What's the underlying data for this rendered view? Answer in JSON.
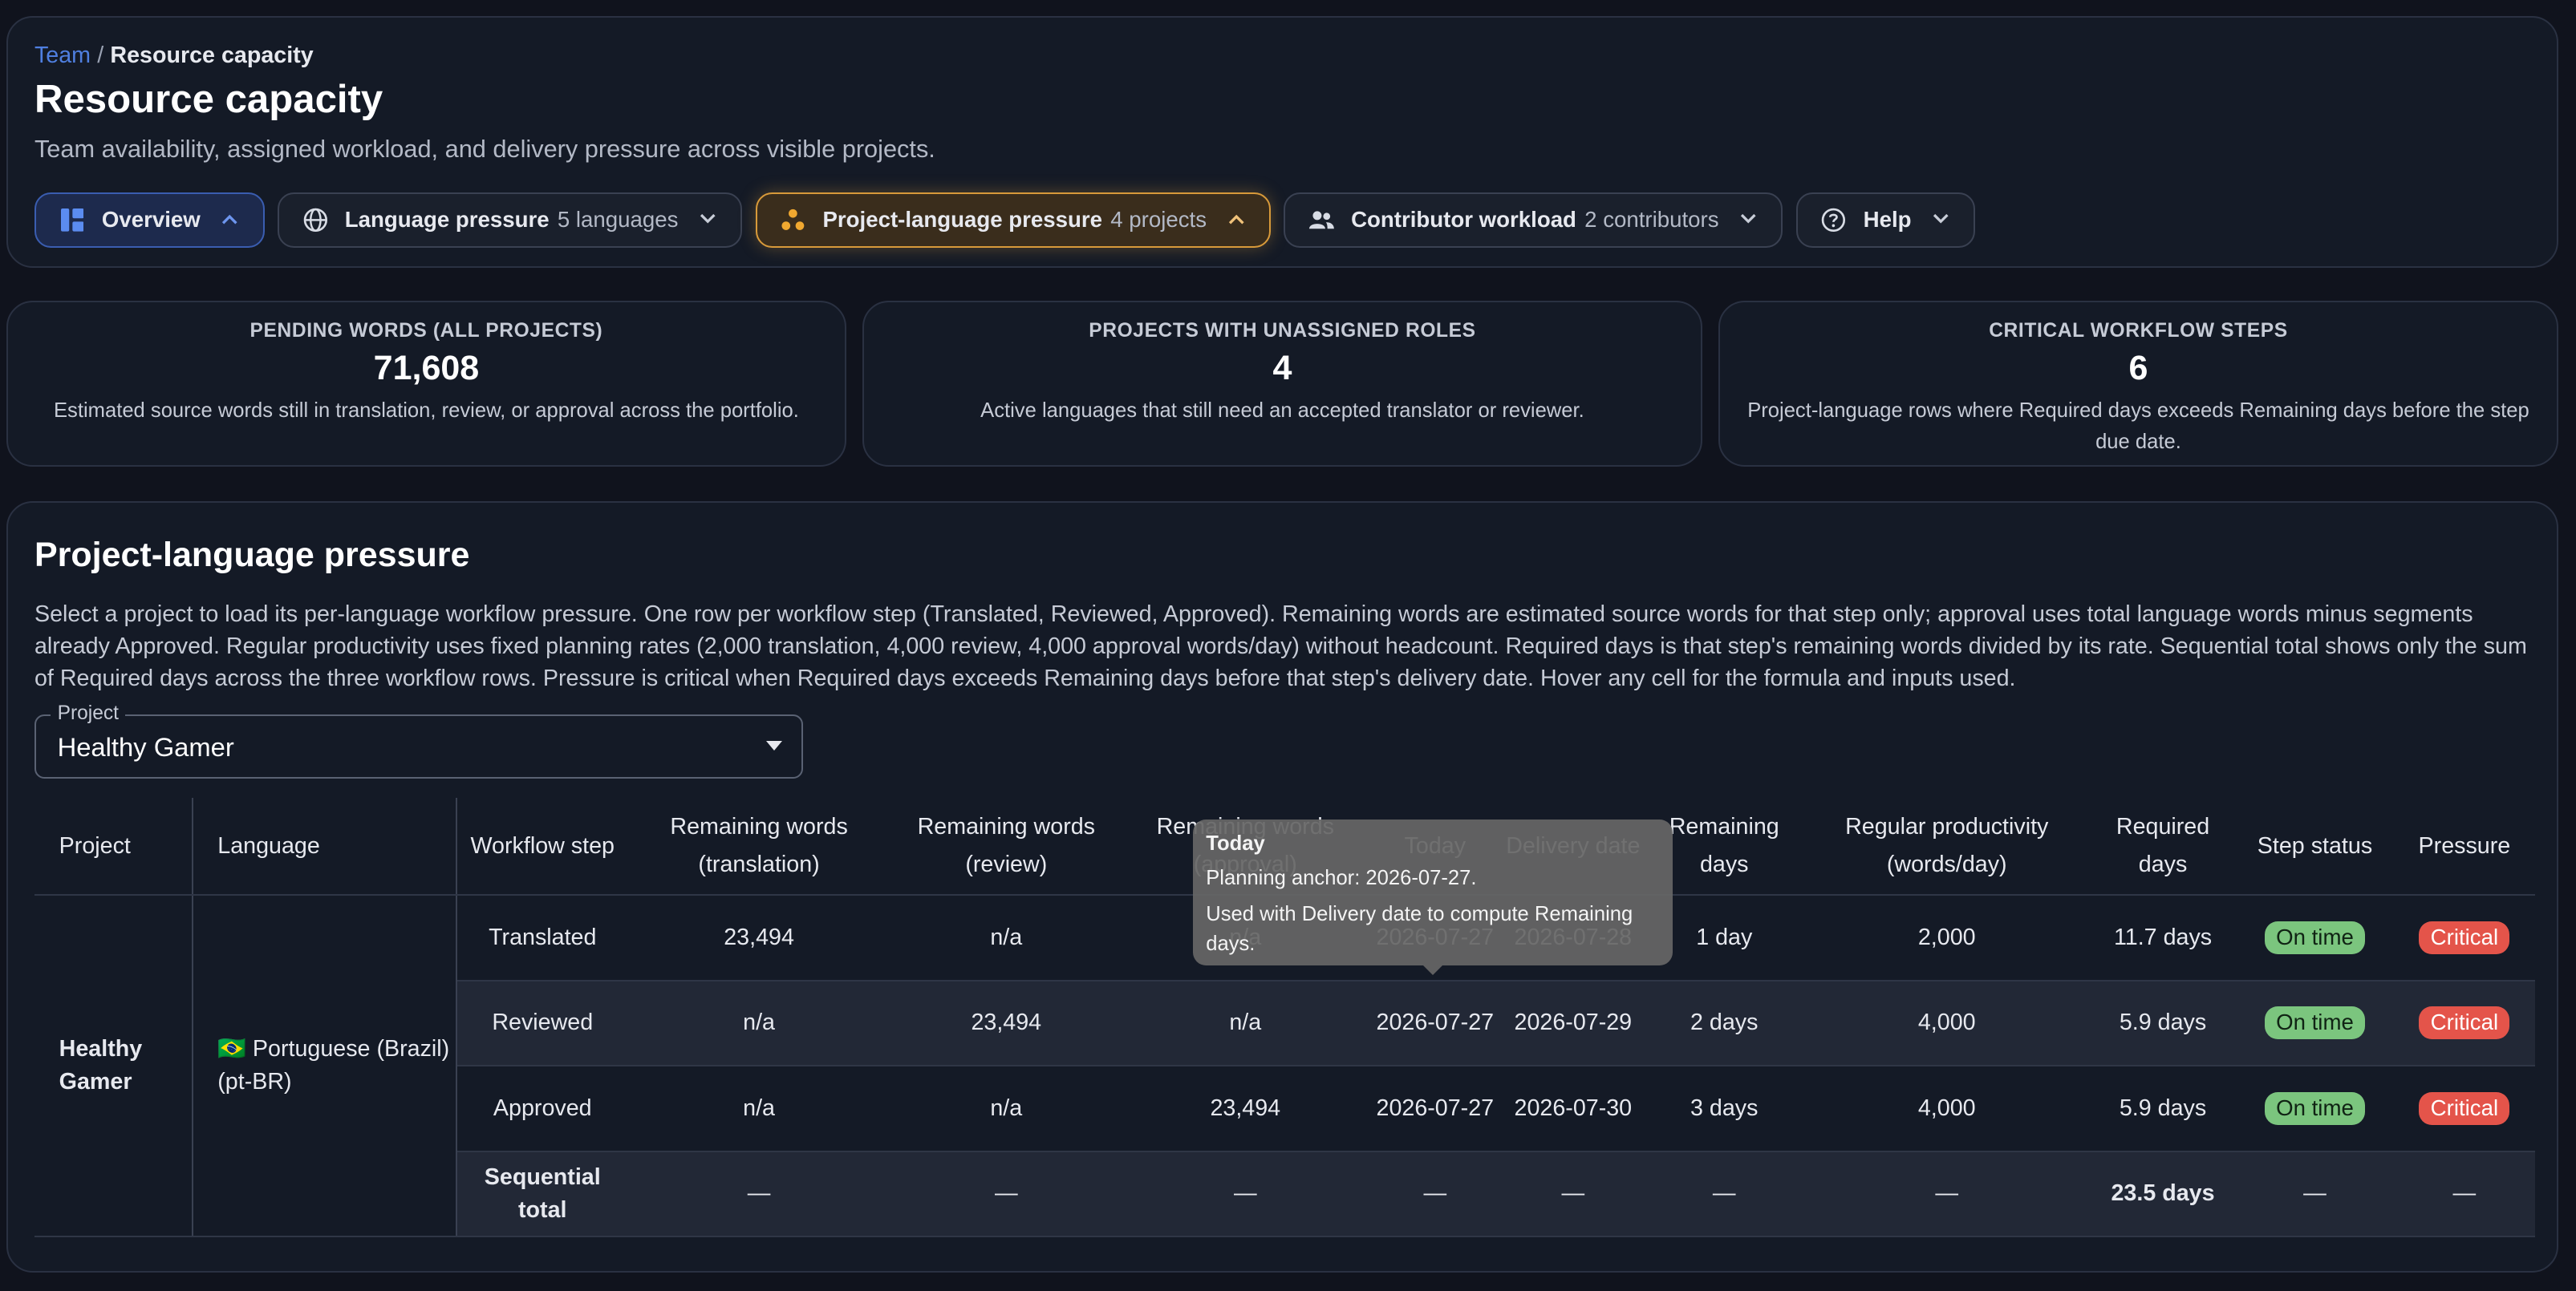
{
  "breadcrumb": {
    "parent": "Team",
    "separator": "/",
    "current": "Resource capacity"
  },
  "page": {
    "title": "Resource capacity",
    "subtitle": "Team availability, assigned workload, and delivery pressure across visible projects."
  },
  "tabs": [
    {
      "label": "Overview",
      "count": "",
      "icon": "grid-icon",
      "state": "active",
      "chevron": "up"
    },
    {
      "label": "Language pressure",
      "count": "5 languages",
      "icon": "globe-icon",
      "state": "normal",
      "chevron": "down"
    },
    {
      "label": "Project-language pressure",
      "count": "4 projects",
      "icon": "cluster-icon",
      "state": "highlight",
      "chevron": "up"
    },
    {
      "label": "Contributor workload",
      "count": "2 contributors",
      "icon": "people-icon",
      "state": "normal",
      "chevron": "down"
    },
    {
      "label": "Help",
      "count": "",
      "icon": "help-icon",
      "state": "normal",
      "chevron": "down"
    }
  ],
  "stats": {
    "pending": {
      "label": "PENDING WORDS (ALL PROJECTS)",
      "value": "71,608",
      "desc": "Estimated source words still in translation, review, or approval across the portfolio."
    },
    "unassigned": {
      "label": "PROJECTS WITH UNASSIGNED ROLES",
      "value": "4",
      "desc": "Active languages that still need an accepted translator or reviewer."
    },
    "critical": {
      "label": "CRITICAL WORKFLOW STEPS",
      "value": "6",
      "desc": "Project-language rows where Required days exceeds Remaining days before the step due date."
    }
  },
  "section": {
    "title": "Project-language pressure",
    "description": "Select a project to load its per-language workflow pressure. One row per workflow step (Translated, Reviewed, Approved). Remaining words are estimated source words for that step only; approval uses total language words minus segments already Approved. Regular productivity uses fixed planning rates (2,000 translation, 4,000 review, 4,000 approval words/day) without headcount. Required days is that step's remaining words divided by its rate. Sequential total shows only the sum of Required days across the three workflow rows. Pressure is critical when Required days exceeds Remaining days before that step's delivery date. Hover any cell for the formula and inputs used."
  },
  "project_select": {
    "legend": "Project",
    "value": "Healthy Gamer"
  },
  "table": {
    "headers": {
      "project": "Project",
      "language": "Language",
      "step": "Workflow step",
      "rw_translation": "Remaining words (translation)",
      "rw_review": "Remaining words (review)",
      "rw_approval": "Remaining words (approval)",
      "today": "Today",
      "delivery": "Delivery date",
      "remaining_days": "Remaining days",
      "productivity": "Regular productivity (words/day)",
      "required": "Required days",
      "step_status": "Step status",
      "pressure": "Pressure"
    },
    "project": "Healthy Gamer",
    "language_flag": "🇧🇷",
    "language": "Portuguese (Brazil) (pt-BR)",
    "rows": [
      {
        "step": "Translated",
        "rw_translation": "23,494",
        "rw_review": "n/a",
        "rw_approval": "n/a",
        "today": "2026-07-27",
        "delivery": "2026-07-28",
        "remaining_days": "1 day",
        "productivity": "2,000",
        "required": "11.7 days",
        "status": "On time",
        "pressure": "Critical"
      },
      {
        "step": "Reviewed",
        "rw_translation": "n/a",
        "rw_review": "23,494",
        "rw_approval": "n/a",
        "today": "2026-07-27",
        "delivery": "2026-07-29",
        "remaining_days": "2 days",
        "productivity": "4,000",
        "required": "5.9 days",
        "status": "On time",
        "pressure": "Critical"
      },
      {
        "step": "Approved",
        "rw_translation": "n/a",
        "rw_review": "n/a",
        "rw_approval": "23,494",
        "today": "2026-07-27",
        "delivery": "2026-07-30",
        "remaining_days": "3 days",
        "productivity": "4,000",
        "required": "5.9 days",
        "status": "On time",
        "pressure": "Critical"
      }
    ],
    "total": {
      "label": "Sequential total",
      "dash": "—",
      "required": "23.5 days"
    }
  },
  "tooltip": {
    "title": "Today",
    "line1": "Planning anchor: 2026-07-27.",
    "line2": "Used with Delivery date to compute Remaining days."
  },
  "colors": {
    "background": "#10131d",
    "accent": "#4f7fe0",
    "highlight": "#d89a3a",
    "on_time": "#7bc57e",
    "critical": "#e4544a"
  }
}
